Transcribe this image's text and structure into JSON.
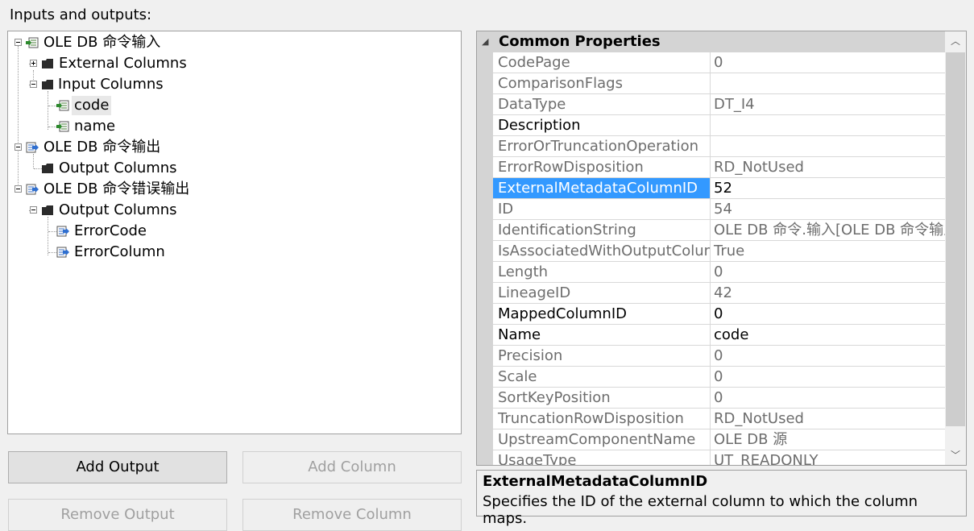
{
  "inputs_outputs_label": "Inputs and outputs:",
  "tree": [
    {
      "label": "OLE DB 命令输入",
      "icon": "input-icon",
      "expander": "minus"
    },
    {
      "label": "External Columns",
      "icon": "folder-icon",
      "expander": "plus"
    },
    {
      "label": "Input Columns",
      "icon": "folder-icon",
      "expander": "minus"
    },
    {
      "label": "code",
      "icon": "input-column-icon",
      "selected": true
    },
    {
      "label": "name",
      "icon": "input-column-icon"
    },
    {
      "label": "OLE DB 命令输出",
      "icon": "output-icon",
      "expander": "minus"
    },
    {
      "label": "Output Columns",
      "icon": "folder-icon"
    },
    {
      "label": "OLE DB 命令错误输出",
      "icon": "output-icon",
      "expander": "minus"
    },
    {
      "label": "Output Columns",
      "icon": "folder-icon",
      "expander": "minus"
    },
    {
      "label": "ErrorCode",
      "icon": "output-column-icon"
    },
    {
      "label": "ErrorColumn",
      "icon": "output-column-icon"
    }
  ],
  "buttons": {
    "add_output": "Add Output",
    "add_column": "Add Column",
    "remove_output": "Remove Output",
    "remove_column": "Remove Column"
  },
  "properties": {
    "category": "Common Properties",
    "rows": [
      {
        "name": "CodePage",
        "value": "0",
        "editable": false
      },
      {
        "name": "ComparisonFlags",
        "value": "",
        "editable": false
      },
      {
        "name": "DataType",
        "value": "DT_I4",
        "editable": false
      },
      {
        "name": "Description",
        "value": "",
        "editable": true
      },
      {
        "name": "ErrorOrTruncationOperation",
        "value": "",
        "editable": false
      },
      {
        "name": "ErrorRowDisposition",
        "value": "RD_NotUsed",
        "editable": false
      },
      {
        "name": "ExternalMetadataColumnID",
        "value": "52",
        "editable": true,
        "selected": true
      },
      {
        "name": "ID",
        "value": "54",
        "editable": false
      },
      {
        "name": "IdentificationString",
        "value": "OLE DB 命令.输入[OLE DB 命令输入",
        "editable": false
      },
      {
        "name": "IsAssociatedWithOutputColum",
        "value": "True",
        "editable": false
      },
      {
        "name": "Length",
        "value": "0",
        "editable": false
      },
      {
        "name": "LineageID",
        "value": "42",
        "editable": false
      },
      {
        "name": "MappedColumnID",
        "value": "0",
        "editable": true
      },
      {
        "name": "Name",
        "value": "code",
        "editable": true
      },
      {
        "name": "Precision",
        "value": "0",
        "editable": false
      },
      {
        "name": "Scale",
        "value": "0",
        "editable": false
      },
      {
        "name": "SortKeyPosition",
        "value": "0",
        "editable": false
      },
      {
        "name": "TruncationRowDisposition",
        "value": "RD_NotUsed",
        "editable": false
      },
      {
        "name": "UpstreamComponentName",
        "value": "OLE DB 源",
        "editable": false
      },
      {
        "name": "UsageType",
        "value": "UT_READONLY",
        "editable": false
      }
    ]
  },
  "description": {
    "title": "ExternalMetadataColumnID",
    "text": "Specifies the ID of the external column to which the column maps."
  },
  "colors": {
    "selection": "#3399ff",
    "disabled_text": "#6d6d6d",
    "category_bg": "#d4d4d4"
  }
}
